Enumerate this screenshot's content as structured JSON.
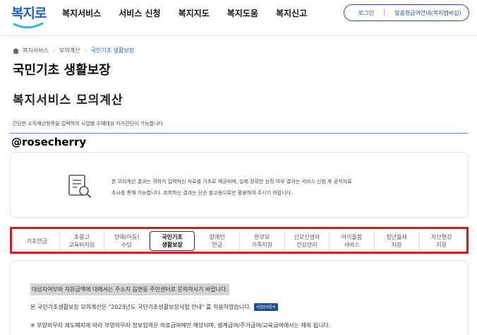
{
  "header": {
    "logo_text": "복지로",
    "nav": [
      "복지서비스",
      "서비스 신청",
      "복지지도",
      "복지도움",
      "복지신고"
    ],
    "login_label": "로그인",
    "benefit_label": "맞춤형급여안내(복지멤버십)"
  },
  "breadcrumb": {
    "items": [
      "복지서비스",
      "모의계산",
      "국민기초 생활보장"
    ]
  },
  "page_title": "국민기초 생활보장",
  "sub_title": "복지서비스 모의계산",
  "description": "간단한 소득재산항목을 입력하여 사업별 수혜대상 자가진단이 가능합니다.",
  "watermark": "@rosecherry",
  "notice": {
    "line1": "본 모의계산 결과는 귀하가 입력하신 자료를 기초로 제공되며, 실제 정확한 선정 여부 결과는 서비스 신청 후 공적자료",
    "line2": "조사를 통해 가능합니다. 조회하신 결과는 단순 참고용으로만 활용하여 주시기 바랍니다."
  },
  "tabs": [
    {
      "line1": "기초연금",
      "line2": ""
    },
    {
      "line1": "초중고",
      "line2": "교육비지원"
    },
    {
      "line1": "장애(아동)",
      "line2": "수당"
    },
    {
      "line1": "국민기초",
      "line2": "생활보장"
    },
    {
      "line1": "장애인",
      "line2": "연금"
    },
    {
      "line1": "한부모",
      "line2": "가족지원"
    },
    {
      "line1": "산모신생아",
      "line2": "건강관리"
    },
    {
      "line1": "아이돌봄",
      "line2": "서비스"
    },
    {
      "line1": "청년월세",
      "line2": "지원"
    },
    {
      "line1": "자산형성",
      "line2": "지원"
    }
  ],
  "active_tab": 3,
  "content": {
    "highlight": "대상자여부와 지원금액에 대해서는 주소지 읍면동 주민센터로 문의하시기 바랍니다.",
    "line2": "본 국민기초생활보장 모의계산은 \"2023년도 국민기초생활보장사업 안내\" 를 적용하였습니다.",
    "line2_badge": "사업안내문서",
    "line3": "※ 부양의무자 제도폐지에 따라 부양의무자 정보입력은 의료급여에만 해당되며, 생계급여/주거급여/교육급여에서는 제외 됩니다."
  },
  "colors": {
    "brand_blue": "#1c5fc7",
    "highlight_red": "#e0151c",
    "line_blue": "#5b8ad8"
  }
}
